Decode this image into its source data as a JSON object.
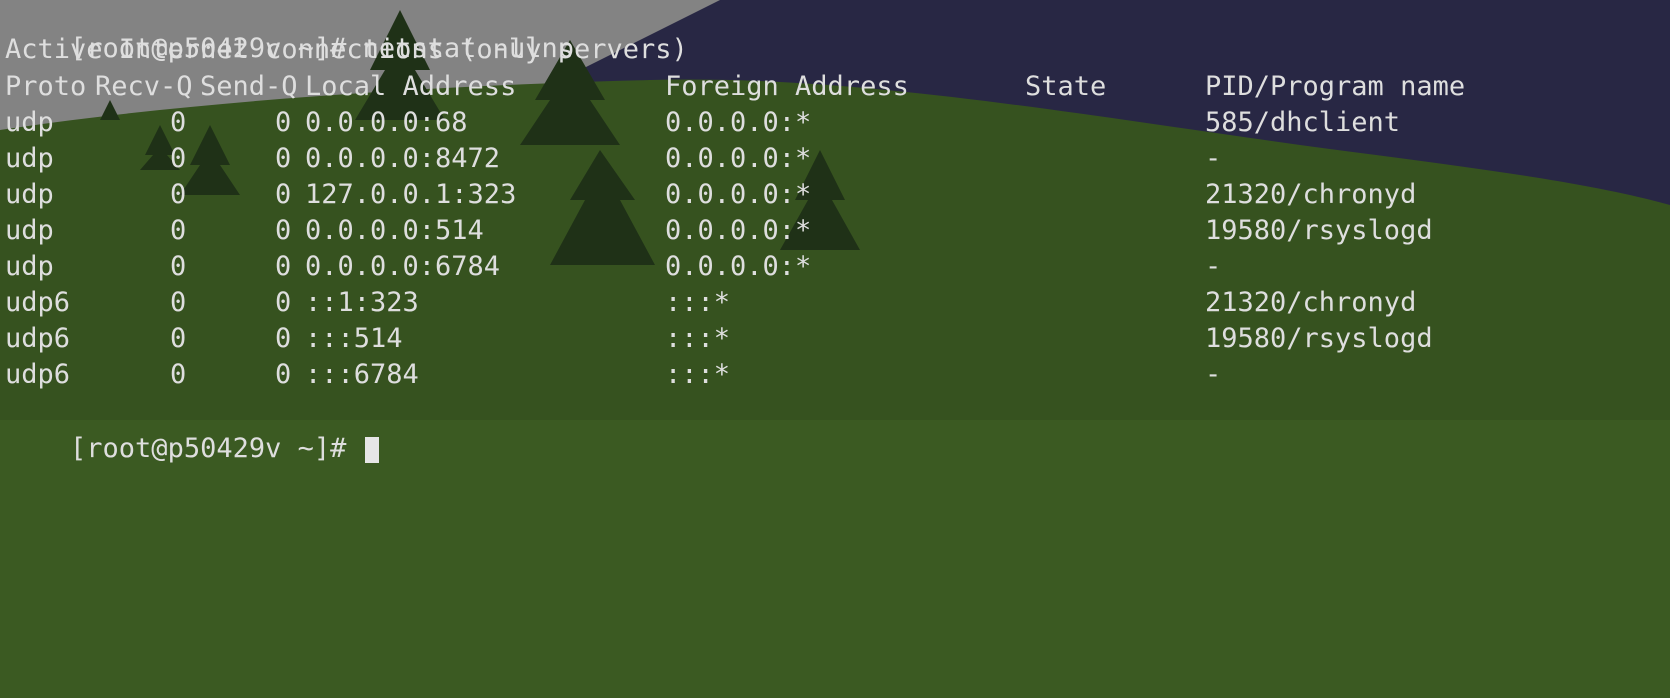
{
  "terminal": {
    "command_prompt": "[root@p50429v ~]# ",
    "command": "netstat -ulnp",
    "heading": "Active Internet connections (only servers)",
    "headers": {
      "proto": "Proto",
      "recv_q": "Recv-Q",
      "send_q": "Send-Q",
      "local_address": "Local Address",
      "foreign_address": "Foreign Address",
      "state": "State",
      "pid_program": "PID/Program name"
    },
    "rows": [
      {
        "proto": "udp",
        "recv_q": "0",
        "send_q": "0",
        "local": "0.0.0.0:68",
        "foreign": "0.0.0.0:*",
        "state": "",
        "pid": "585/dhclient"
      },
      {
        "proto": "udp",
        "recv_q": "0",
        "send_q": "0",
        "local": "0.0.0.0:8472",
        "foreign": "0.0.0.0:*",
        "state": "",
        "pid": "-"
      },
      {
        "proto": "udp",
        "recv_q": "0",
        "send_q": "0",
        "local": "127.0.0.1:323",
        "foreign": "0.0.0.0:*",
        "state": "",
        "pid": "21320/chronyd"
      },
      {
        "proto": "udp",
        "recv_q": "0",
        "send_q": "0",
        "local": "0.0.0.0:514",
        "foreign": "0.0.0.0:*",
        "state": "",
        "pid": "19580/rsyslogd"
      },
      {
        "proto": "udp",
        "recv_q": "0",
        "send_q": "0",
        "local": "0.0.0.0:6784",
        "foreign": "0.0.0.0:*",
        "state": "",
        "pid": "-"
      },
      {
        "proto": "udp6",
        "recv_q": "0",
        "send_q": "0",
        "local": "::1:323",
        "foreign": ":::*",
        "state": "",
        "pid": "21320/chronyd"
      },
      {
        "proto": "udp6",
        "recv_q": "0",
        "send_q": "0",
        "local": ":::514",
        "foreign": ":::*",
        "state": "",
        "pid": "19580/rsyslogd"
      },
      {
        "proto": "udp6",
        "recv_q": "0",
        "send_q": "0",
        "local": ":::6784",
        "foreign": ":::*",
        "state": "",
        "pid": "-"
      }
    ],
    "next_prompt": "[root@p50429v ~]# "
  },
  "colors": {
    "text": "#dedede",
    "sky": "#8f8f8f",
    "mountain": "#2c2b4a",
    "grass": "#3b5a22",
    "tree": "#22361a"
  }
}
